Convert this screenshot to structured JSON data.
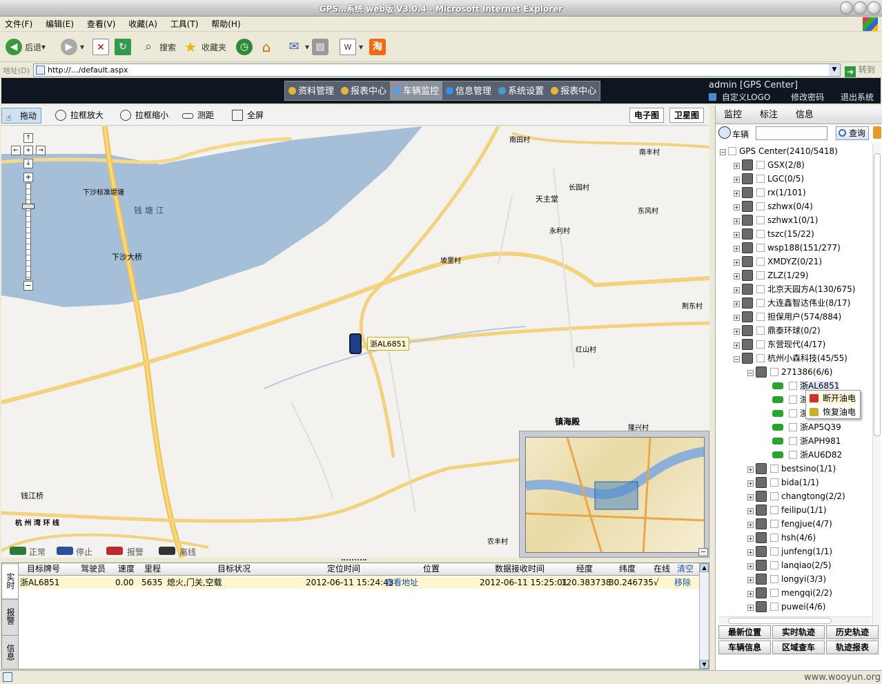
{
  "window": {
    "title": "GPS…系统 web版 V3.0.4 - Microsoft Internet Explorer"
  },
  "menu": [
    "文件(F)",
    "编辑(E)",
    "查看(V)",
    "收藏(A)",
    "工具(T)",
    "帮助(H)"
  ],
  "toolbar": {
    "back": "后退",
    "search": "搜索",
    "favorites": "收藏夹"
  },
  "address": {
    "label": "地址(D)",
    "url": "http://…/default.aspx",
    "go": "转到"
  },
  "nav": [
    {
      "label": "资料管理"
    },
    {
      "label": "报表中心"
    },
    {
      "label": "车辆监控"
    },
    {
      "label": "信息管理"
    },
    {
      "label": "系统设置"
    },
    {
      "label": "报表中心"
    }
  ],
  "user": {
    "name": "admin [GPS Center]",
    "logo": "自定义LOGO",
    "password": "修改密码",
    "logout": "退出系统"
  },
  "maptools": {
    "pan": "拖动",
    "zoomin": "拉框放大",
    "zoomout": "拉框缩小",
    "measure": "测距",
    "full": "全屏",
    "emap": "电子图",
    "sat": "卫星图"
  },
  "map": {
    "vehicle_label": "浙AL6851",
    "places": [
      {
        "t": "钱 塘 江"
      },
      {
        "t": "下沙大桥"
      },
      {
        "t": "天主堂"
      },
      {
        "t": "长园村"
      },
      {
        "t": "永利村"
      },
      {
        "t": "东风村"
      },
      {
        "t": "坡里村"
      },
      {
        "t": "红山村"
      },
      {
        "t": "镇海殿"
      },
      {
        "t": "隆兴村"
      },
      {
        "t": "钱江桥"
      },
      {
        "t": "农丰村"
      },
      {
        "t": "南田村"
      },
      {
        "t": "南丰村"
      },
      {
        "t": "荆东村"
      },
      {
        "t": "下沙标准堤塘"
      },
      {
        "t": "杭 州 湾 环 线"
      }
    ]
  },
  "legend": [
    "正常",
    "停止",
    "报警",
    "离线"
  ],
  "grid": {
    "side_tabs": [
      "实时",
      "报警",
      "信息"
    ],
    "headers": [
      "目标牌号",
      "驾驶员",
      "速度",
      "里程",
      "目标状况",
      "定位时间",
      "位置",
      "数据接收时间",
      "经度",
      "纬度",
      "在线",
      "清空"
    ],
    "row": [
      "浙AL6851",
      "",
      "0.00",
      "5635",
      "熄火,门关,空载",
      "2012-06-11 15:24:43",
      "查看地址",
      "2012-06-11 15:25:01",
      "120.383738",
      "30.246735",
      "√",
      "移除"
    ]
  },
  "panel": {
    "tabs": [
      "监控",
      "标注",
      "信息"
    ],
    "search_label": "车辆",
    "search_btn": "查询",
    "root": "GPS Center(2410/5418)",
    "groups": [
      "GSX(2/8)",
      "LGC(0/5)",
      "rx(1/101)",
      "szhwx(0/4)",
      "szhwx1(0/1)",
      "tszc(15/22)",
      "wsp188(151/277)",
      "XMDYZ(0/21)",
      "ZLZ(1/29)",
      "北京天园方A(130/675)",
      "大连鑫智达伟业(8/17)",
      "担保用户(574/884)",
      "鼎泰环球(0/2)",
      "东营现代(4/17)",
      "杭州小森科技(45/55)"
    ],
    "subgroup": "271386(6/6)",
    "vehicles": [
      "浙AL6851",
      "浙",
      "浙",
      "浙AP5Q39",
      "浙APH981",
      "浙AU6D82"
    ],
    "subgroups2": [
      "bestsino(1/1)",
      "bida(1/1)",
      "changtong(2/2)",
      "feilipu(1/1)",
      "fengjue(4/7)",
      "hsh(4/6)",
      "junfeng(1/1)",
      "lanqiao(2/5)",
      "longyi(3/3)",
      "mengqi(2/2)",
      "puwei(4/6)"
    ],
    "context": [
      "断开油电",
      "恢复油电"
    ],
    "buttons": [
      "最新位置",
      "实时轨迹",
      "历史轨迹",
      "车辆信息",
      "区域查车",
      "轨迹报表"
    ]
  },
  "status": {
    "watermark": "www.wooyun.org"
  }
}
